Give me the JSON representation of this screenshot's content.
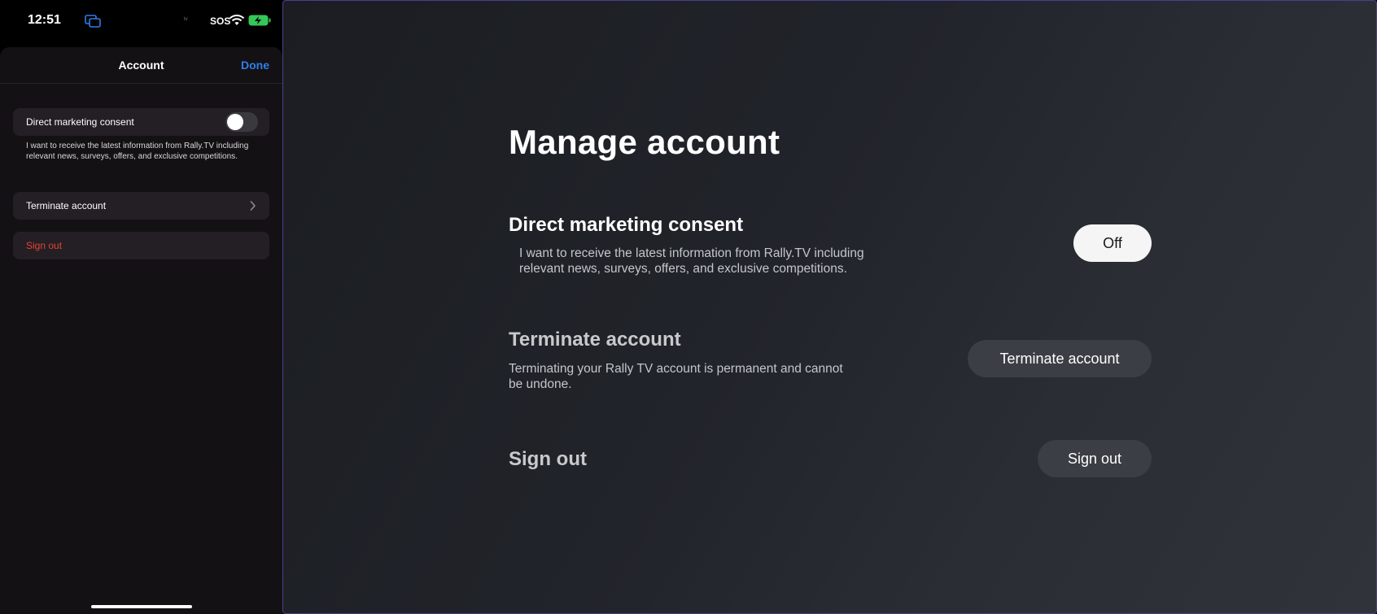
{
  "phone": {
    "status_bar": {
      "time": "12:51",
      "appletv_label": "tv",
      "sos": "SOS"
    },
    "sheet": {
      "title": "Account",
      "done_label": "Done",
      "consent": {
        "label": "Direct marketing consent",
        "enabled": false,
        "footnote": "I want to receive the latest information from Rally.TV including relevant news, surveys, offers, and exclusive competitions."
      },
      "terminate_label": "Terminate account",
      "signout_label": "Sign out"
    },
    "colors": {
      "done": "#2f7ee8",
      "signout": "#e5432f"
    }
  },
  "tv": {
    "title": "Manage account",
    "consent": {
      "title": "Direct marketing consent",
      "description": "I want to receive the latest information from Rally.TV including relevant news, surveys, offers, and exclusive competitions.",
      "button_label": "Off"
    },
    "terminate": {
      "title": "Terminate account",
      "description": "Terminating your Rally TV account is permanent and cannot be undone.",
      "button_label": "Terminate account"
    },
    "signout": {
      "title": "Sign out",
      "button_label": "Sign out"
    }
  }
}
